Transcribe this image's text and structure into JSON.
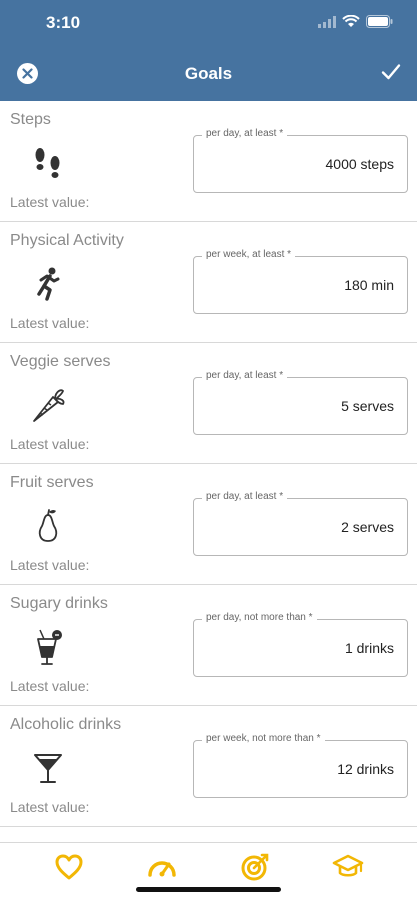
{
  "status_bar": {
    "time": "3:10"
  },
  "nav": {
    "title": "Goals"
  },
  "goals": [
    {
      "label": "Steps",
      "icon": "footprints-icon",
      "latest": "Latest value:",
      "legend": "per day, at least *",
      "value": "4000 steps"
    },
    {
      "label": "Physical Activity",
      "icon": "running-person-icon",
      "latest": "Latest value:",
      "legend": "per week, at least *",
      "value": "180 min"
    },
    {
      "label": "Veggie serves",
      "icon": "carrot-icon",
      "latest": "Latest value:",
      "legend": "per day, at least *",
      "value": "5 serves"
    },
    {
      "label": "Fruit serves",
      "icon": "pear-icon",
      "latest": "Latest value:",
      "legend": "per day, at least *",
      "value": "2 serves"
    },
    {
      "label": "Sugary drinks",
      "icon": "sugary-drink-icon",
      "latest": "Latest value:",
      "legend": "per day, not more than *",
      "value": "1 drinks"
    },
    {
      "label": "Alcoholic drinks",
      "icon": "cocktail-glass-icon",
      "latest": "Latest value:",
      "legend": "per week, not more than *",
      "value": "12 drinks"
    }
  ],
  "tabbar": {
    "accent_color": "#f2b705",
    "tabs": [
      {
        "icon": "heart-icon"
      },
      {
        "icon": "speedometer-icon"
      },
      {
        "icon": "target-icon"
      },
      {
        "icon": "graduation-cap-icon"
      }
    ]
  }
}
